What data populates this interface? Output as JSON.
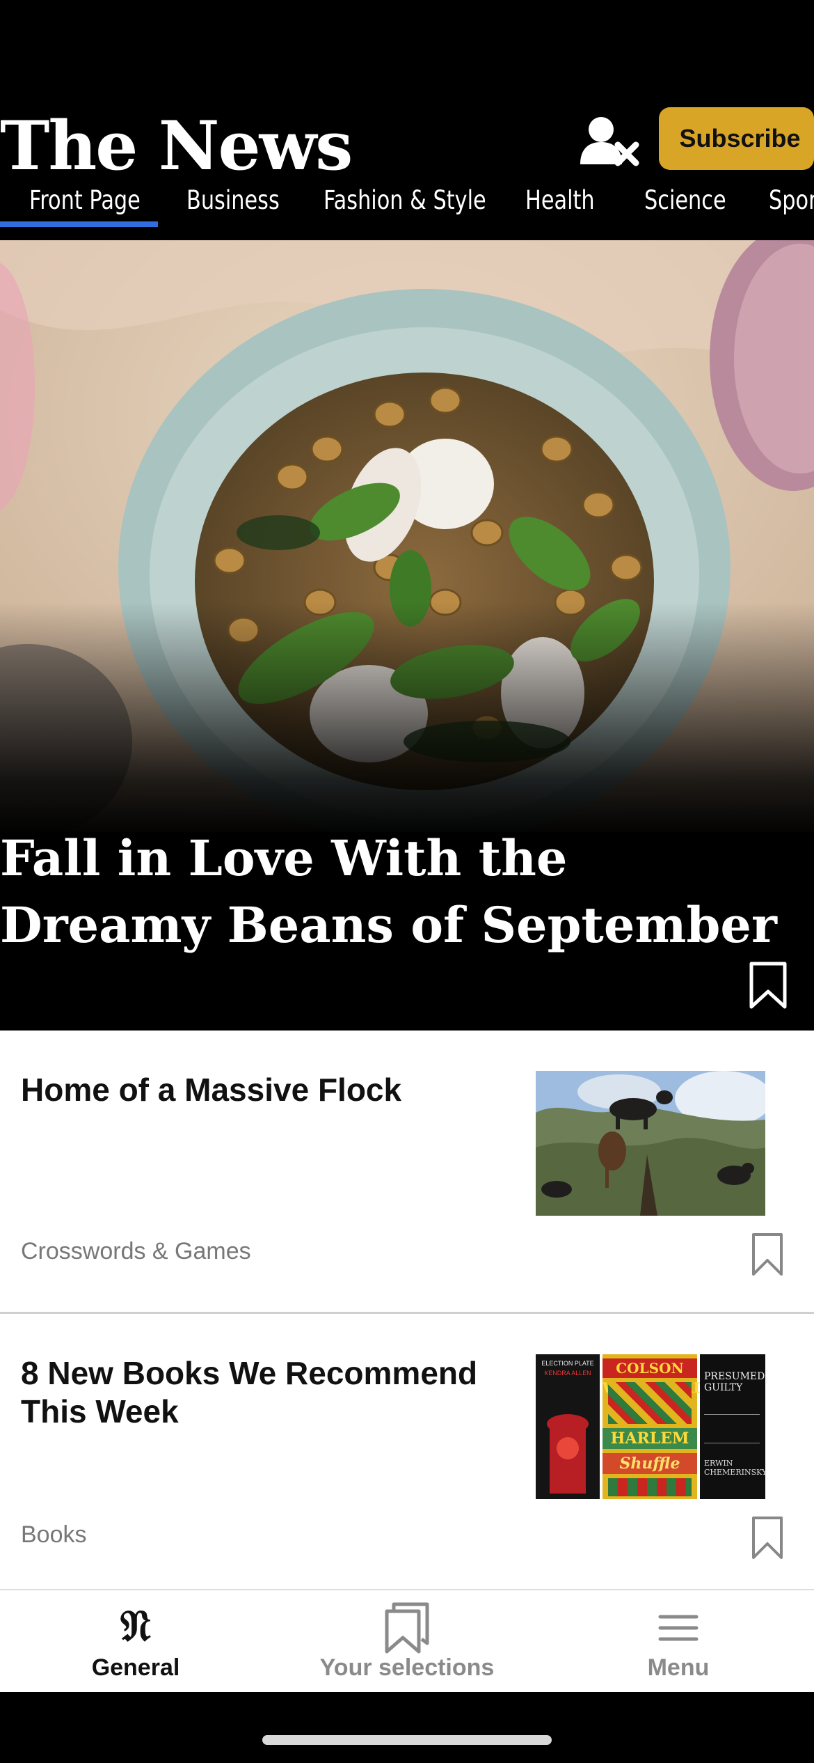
{
  "header": {
    "logo_text": "The News",
    "account_icon": "account-blocked-icon",
    "subscribe_label": "Subscribe",
    "tabs": [
      {
        "label": "Front Page",
        "active": true
      },
      {
        "label": "Business"
      },
      {
        "label": "Fashion & Style"
      },
      {
        "label": "Health"
      },
      {
        "label": "Science"
      },
      {
        "label": "Sports"
      }
    ]
  },
  "hero": {
    "image": "bean-soup-photo",
    "title_line1": "Fall in Love With the",
    "title_line2": "Dreamy Beans of September",
    "bookmark_icon": "bookmark-icon"
  },
  "articles": [
    {
      "title": "Home of a Massive Flock",
      "section": "Crosswords & Games",
      "image": "goats-in-tree-photo"
    },
    {
      "title": "8 New Books We Recommend This Week",
      "section": "Books",
      "image": "book-covers-photo",
      "covers": [
        {
          "text": "ELECTION PLATE",
          "author": "KENDRA ALLEN"
        },
        {
          "text": "COLSON WHITEHEAD",
          "title": "HARLEM",
          "sub": "Shuffle"
        },
        {
          "text": "PRESUMED GUILTY",
          "author": "ERWIN CHEMERINSKY"
        }
      ]
    }
  ],
  "tabbar": {
    "items": [
      {
        "label": "General",
        "icon": "news-logo-icon",
        "active": true
      },
      {
        "label": "Your selections",
        "icon": "bookmarks-icon"
      },
      {
        "label": "Menu",
        "icon": "hamburger-menu-icon"
      }
    ]
  },
  "colors": {
    "accent": "#2F6FE0",
    "subscribe": "#D9A527",
    "inactive_tab": "#8A8A8A"
  }
}
